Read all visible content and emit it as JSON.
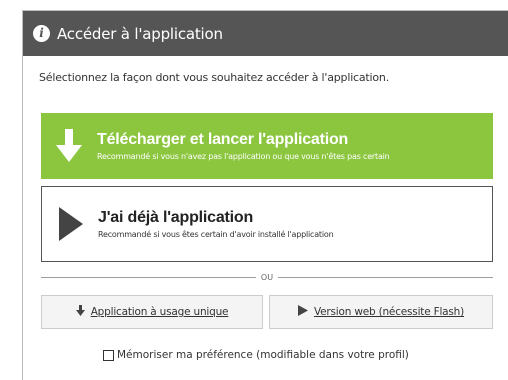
{
  "dialog": {
    "title": "Accéder à l'application",
    "title_icon": "info-icon",
    "subtitle": "Sélectionnez la façon dont vous souhaitez accéder à l'application."
  },
  "options": {
    "download": {
      "title": "Télécharger et lancer l'application",
      "description": "Recommandé si vous n'avez pas l'application ou que vous n'êtes pas certain",
      "icon": "download-arrow-icon",
      "color": "#8cc63f"
    },
    "launch": {
      "title": "J'ai déjà l'application",
      "description": "Recommandé si vous êtes certain d'avoir installé l'application",
      "icon": "play-icon"
    }
  },
  "divider": {
    "text": "ou"
  },
  "alternatives": {
    "single_use": {
      "label": "Application à usage unique",
      "icon": "download-arrow-icon"
    },
    "web": {
      "label": "Version web (nécessite Flash)",
      "icon": "play-icon"
    }
  },
  "remember": {
    "label": "Mémoriser ma préférence (modifiable dans votre profil)",
    "checked": false
  },
  "colors": {
    "titlebar": "#555555",
    "primary": "#8cc63f"
  }
}
